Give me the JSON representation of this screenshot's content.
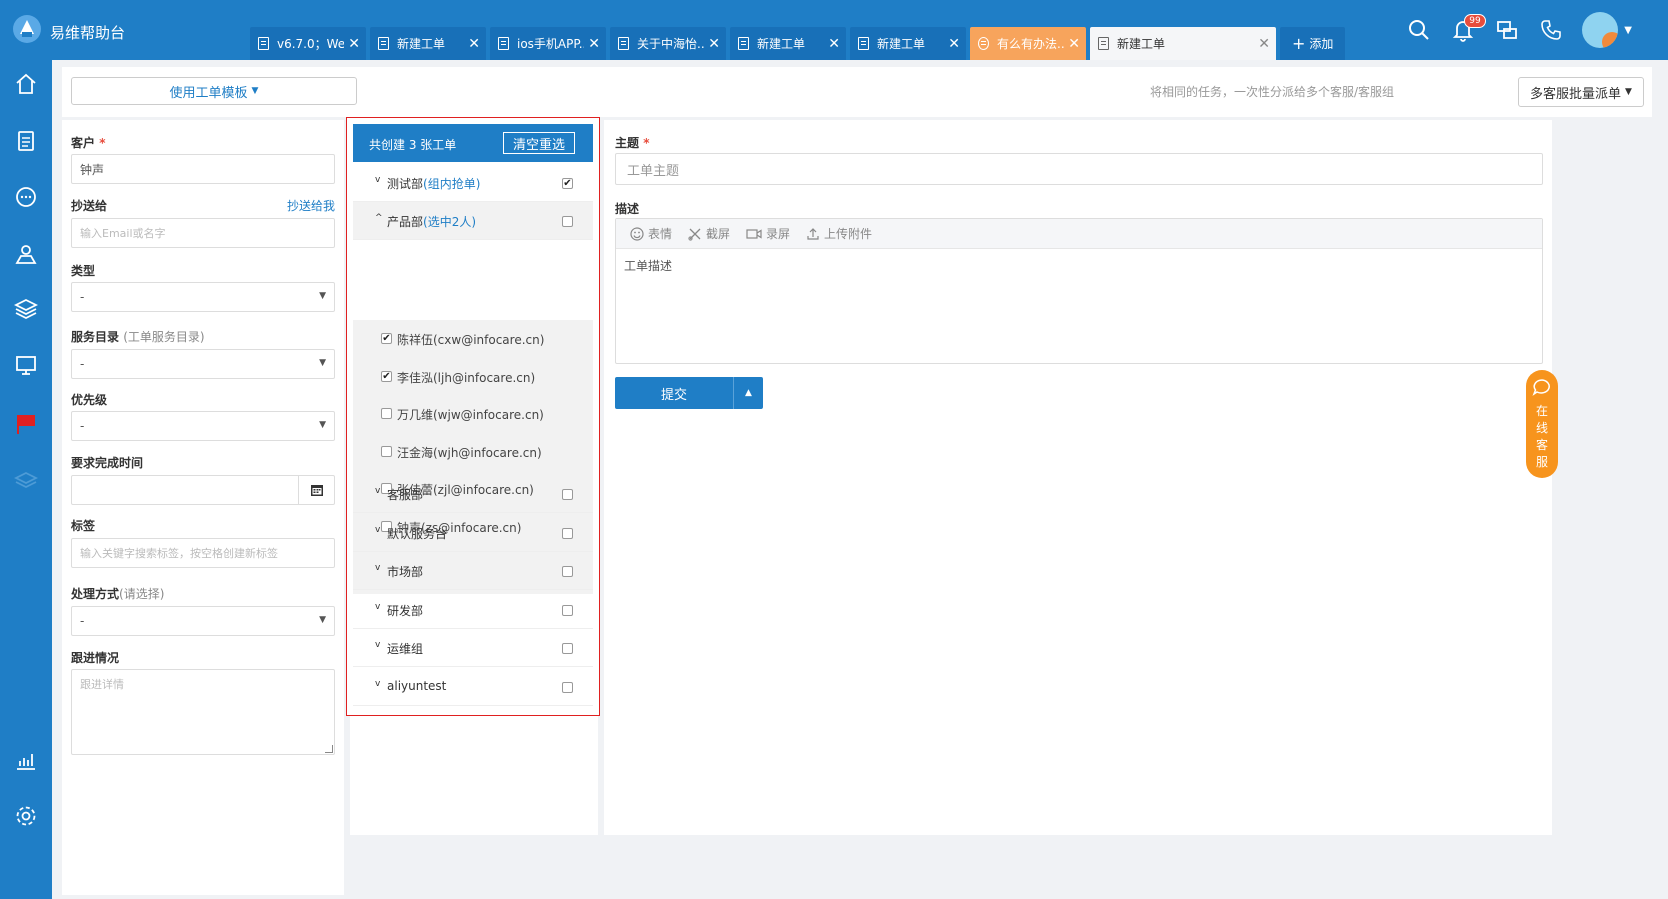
{
  "app": {
    "title": "易维帮助台"
  },
  "tabs": [
    {
      "label": "v6.7.0；We...",
      "style": "normal"
    },
    {
      "label": "新建工单",
      "style": "normal"
    },
    {
      "label": "ios手机APP...",
      "style": "normal"
    },
    {
      "label": "关于中海怡...",
      "style": "normal"
    },
    {
      "label": "新建工单",
      "style": "normal"
    },
    {
      "label": "新建工单",
      "style": "normal"
    },
    {
      "label": "有么有办法...",
      "style": "orange"
    },
    {
      "label": "新建工单",
      "style": "active"
    }
  ],
  "tab_add_label": "添加",
  "notification_count": "99",
  "template_button": "使用工单模板",
  "hint_text": "将相同的任务，一次性分派给多个客服/客服组",
  "batch_button": "多客服批量派单",
  "form": {
    "customer_label": "客户",
    "customer_value": "钟声",
    "cc_label": "抄送给",
    "cc_link": "抄送给我",
    "cc_placeholder": "输入Email或名字",
    "type_label": "类型",
    "type_value": "-",
    "catalog_label": "服务目录",
    "catalog_sub": "(工单服务目录)",
    "catalog_value": "-",
    "priority_label": "优先级",
    "priority_value": "-",
    "due_label": "要求完成时间",
    "tags_label": "标签",
    "tags_placeholder": "输入关键字搜索标签，按空格创建新标签",
    "method_label": "处理方式",
    "method_sub": "(请选择)",
    "method_value": "-",
    "followup_label": "跟进情况",
    "followup_placeholder": "跟进详情"
  },
  "assign": {
    "count_text": "共创建 3 张工单",
    "clear_button": "清空重选",
    "groups_top": [
      {
        "name": "测试部",
        "note": "(组内抢单)",
        "checked": true,
        "expanded": false
      },
      {
        "name": "产品部",
        "note": "(选中2人)",
        "checked": false,
        "expanded": true
      }
    ],
    "members": [
      {
        "label": "陈祥伍(cxw@infocare.cn)",
        "checked": true
      },
      {
        "label": "李佳泓(ljh@infocare.cn)",
        "checked": true
      },
      {
        "label": "万几维(wjw@infocare.cn)",
        "checked": false
      },
      {
        "label": "汪金海(wjh@infocare.cn)",
        "checked": false
      },
      {
        "label": "张佳蕾(zjl@infocare.cn)",
        "checked": false
      },
      {
        "label": "钟声(zs@infocare.cn)",
        "checked": false
      }
    ],
    "groups_bottom": [
      {
        "name": "客服部",
        "checked": false
      },
      {
        "name": "默认服务台",
        "checked": false
      },
      {
        "name": "市场部",
        "checked": false
      },
      {
        "name": "研发部",
        "checked": false
      },
      {
        "name": "运维组",
        "checked": false
      },
      {
        "name": "aliyuntest",
        "checked": false
      }
    ]
  },
  "ticket": {
    "subject_label": "主题",
    "subject_placeholder": "工单主题",
    "desc_label": "描述",
    "toolbar": [
      "表情",
      "截屏",
      "录屏",
      "上传附件"
    ],
    "desc_text": "工单描述",
    "submit_label": "提交"
  },
  "online_service": "在线客服",
  "colors": {
    "primary": "#1f7ec6",
    "orange": "#f7941d",
    "required": "#e74c3c"
  }
}
